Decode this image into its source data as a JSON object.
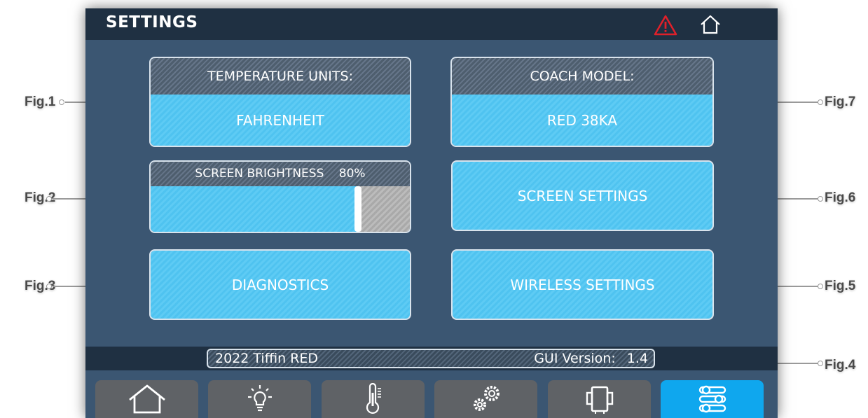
{
  "header": {
    "title": "SETTINGS",
    "icons": [
      "warning-icon",
      "home-icon"
    ]
  },
  "panels": {
    "temperature_units": {
      "label": "TEMPERATURE UNITS:",
      "value": "FAHRENHEIT"
    },
    "coach_model": {
      "label": "COACH MODEL:",
      "value": "RED 38KA"
    },
    "screen_brightness": {
      "label": "SCREEN BRIGHTNESS",
      "value_text": "80%",
      "value": 80
    }
  },
  "buttons": {
    "screen_settings": "SCREEN SETTINGS",
    "diagnostics": "DIAGNOSTICS",
    "wireless_settings": "WIRELESS SETTINGS"
  },
  "status": {
    "model_year": "2022 Tiffin RED",
    "gui_version_label": "GUI Version:",
    "gui_version": "1.4"
  },
  "nav_tabs": [
    {
      "icon": "home-icon",
      "active": false
    },
    {
      "icon": "lightbulb-icon",
      "active": false
    },
    {
      "icon": "thermometer-icon",
      "active": false
    },
    {
      "icon": "gears-icon",
      "active": false
    },
    {
      "icon": "slide-out-icon",
      "active": false
    },
    {
      "icon": "settings-sliders-icon",
      "active": true
    }
  ],
  "figure_labels": [
    "Fig.1",
    "Fig.2",
    "Fig.3",
    "Fig.4",
    "Fig.5",
    "Fig.6",
    "Fig.7"
  ],
  "colors": {
    "accent": "#4fc3f0",
    "active_tab": "#0fa7ee",
    "warning": "#e0202a",
    "background": "#3b5672"
  }
}
